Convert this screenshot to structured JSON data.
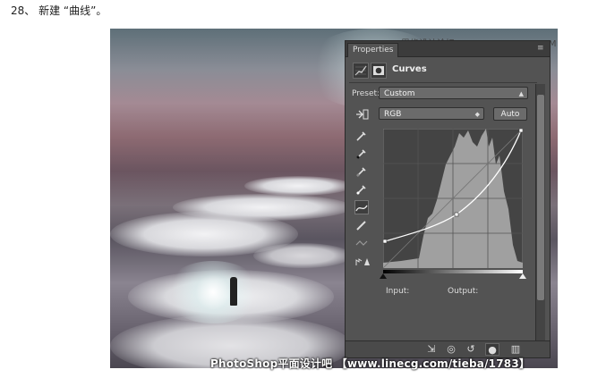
{
  "caption": "28、 新建 “曲线”。",
  "watermark_top": "思缘设计论坛 WWW.MISSYUAN.COM",
  "watermark_bottom": "PhotoShop平面设计吧 【www.linecg.com/tieba/1783】",
  "panel": {
    "tab_label": "Properties",
    "title": "Curves",
    "preset_label": "Preset:",
    "preset_value": "Custom",
    "channel_value": "RGB",
    "auto_label": "Auto",
    "input_label": "Input:",
    "output_label": "Output:"
  },
  "tools": [
    "eyedropper-sample-icon",
    "eyedropper-black-icon",
    "eyedropper-gray-icon",
    "eyedropper-white-icon",
    "curve-point-icon",
    "pencil-icon",
    "smooth-icon",
    "clipping-warning-icon"
  ],
  "footer_icons": [
    "clip-to-layer-icon",
    "view-previous-icon",
    "reset-icon",
    "visibility-eye-icon",
    "delete-icon"
  ],
  "colors": {
    "panel_bg": "#535353",
    "graph_bg": "#444444",
    "histogram": "#a0a0a0",
    "curve": "#ffffff"
  }
}
